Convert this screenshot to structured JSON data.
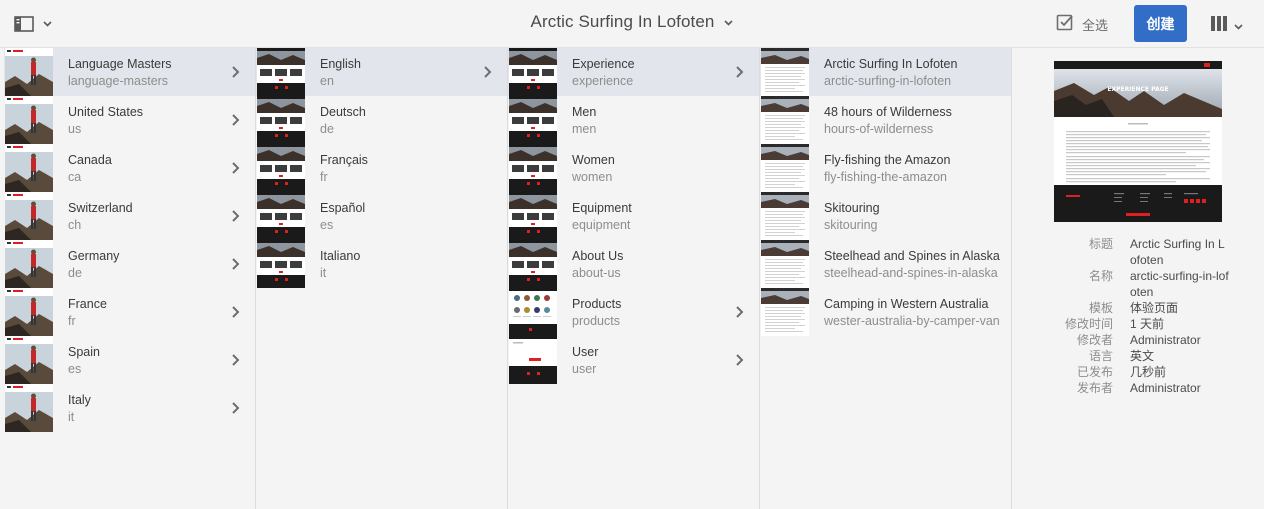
{
  "header": {
    "title": "Arctic Surfing In Lofoten",
    "select_all_label": "全选",
    "create_label": "创建"
  },
  "columns": [
    {
      "items": [
        {
          "title": "Language Masters",
          "name": "language-masters",
          "has_children": true,
          "selected": true,
          "thumb": "red"
        },
        {
          "title": "United States",
          "name": "us",
          "has_children": true,
          "selected": false,
          "thumb": "red"
        },
        {
          "title": "Canada",
          "name": "ca",
          "has_children": true,
          "selected": false,
          "thumb": "red"
        },
        {
          "title": "Switzerland",
          "name": "ch",
          "has_children": true,
          "selected": false,
          "thumb": "red"
        },
        {
          "title": "Germany",
          "name": "de",
          "has_children": true,
          "selected": false,
          "thumb": "red"
        },
        {
          "title": "France",
          "name": "fr",
          "has_children": true,
          "selected": false,
          "thumb": "red"
        },
        {
          "title": "Spain",
          "name": "es",
          "has_children": true,
          "selected": false,
          "thumb": "red"
        },
        {
          "title": "Italy",
          "name": "it",
          "has_children": true,
          "selected": false,
          "thumb": "red"
        }
      ]
    },
    {
      "items": [
        {
          "title": "English",
          "name": "en",
          "has_children": true,
          "selected": true,
          "thumb": "site"
        },
        {
          "title": "Deutsch",
          "name": "de",
          "has_children": false,
          "selected": false,
          "thumb": "site"
        },
        {
          "title": "Français",
          "name": "fr",
          "has_children": false,
          "selected": false,
          "thumb": "site"
        },
        {
          "title": "Español",
          "name": "es",
          "has_children": false,
          "selected": false,
          "thumb": "site"
        },
        {
          "title": "Italiano",
          "name": "it",
          "has_children": false,
          "selected": false,
          "thumb": "site"
        }
      ]
    },
    {
      "items": [
        {
          "title": "Experience",
          "name": "experience",
          "has_children": true,
          "selected": true,
          "thumb": "site"
        },
        {
          "title": "Men",
          "name": "men",
          "has_children": false,
          "selected": false,
          "thumb": "site"
        },
        {
          "title": "Women",
          "name": "women",
          "has_children": false,
          "selected": false,
          "thumb": "site"
        },
        {
          "title": "Equipment",
          "name": "equipment",
          "has_children": false,
          "selected": false,
          "thumb": "site"
        },
        {
          "title": "About Us",
          "name": "about-us",
          "has_children": false,
          "selected": false,
          "thumb": "site"
        },
        {
          "title": "Products",
          "name": "products",
          "has_children": true,
          "selected": false,
          "thumb": "products"
        },
        {
          "title": "User",
          "name": "user",
          "has_children": true,
          "selected": false,
          "thumb": "user"
        }
      ]
    },
    {
      "items": [
        {
          "title": "Arctic Surfing In Lofoten",
          "name": "arctic-surfing-in-lofoten",
          "has_children": false,
          "selected": true,
          "thumb": "article"
        },
        {
          "title": "48 hours of Wilderness",
          "name": "hours-of-wilderness",
          "has_children": false,
          "selected": false,
          "thumb": "article"
        },
        {
          "title": "Fly-fishing the Amazon",
          "name": "fly-fishing-the-amazon",
          "has_children": false,
          "selected": false,
          "thumb": "article"
        },
        {
          "title": "Skitouring",
          "name": "skitouring",
          "has_children": false,
          "selected": false,
          "thumb": "article"
        },
        {
          "title": "Steelhead and Spines in Alaska",
          "name": "steelhead-and-spines-in-alaska",
          "has_children": false,
          "selected": false,
          "thumb": "article"
        },
        {
          "title": "Camping in Western Australia",
          "name": "wester-australia-by-camper-van",
          "has_children": false,
          "selected": false,
          "thumb": "article"
        }
      ]
    }
  ],
  "preview": {
    "hero_text": "EXPERIENCE PAGE",
    "meta": [
      {
        "key": "标题",
        "value": "Arctic Surfing In Lofoten"
      },
      {
        "key": "名称",
        "value": "arctic-surfing-in-lofoten"
      },
      {
        "key": "模板",
        "value": "体验页面"
      },
      {
        "key": "修改时间",
        "value": "1 天前"
      },
      {
        "key": "修改者",
        "value": "Administrator"
      },
      {
        "key": "语言",
        "value": "英文"
      },
      {
        "key": "已发布",
        "value": "几秒前"
      },
      {
        "key": "发布者",
        "value": "Administrator"
      }
    ]
  },
  "colors": {
    "accent": "#326ec8",
    "selected_row": "#e2e6ec",
    "background": "#f4f4f4"
  },
  "icons": {
    "rail": "rail-toggle-icon",
    "title_menu": "chevron-down-icon",
    "select_all": "checkbox-icon",
    "view": "column-view-icon",
    "row_arrow": "chevron-right-icon"
  }
}
